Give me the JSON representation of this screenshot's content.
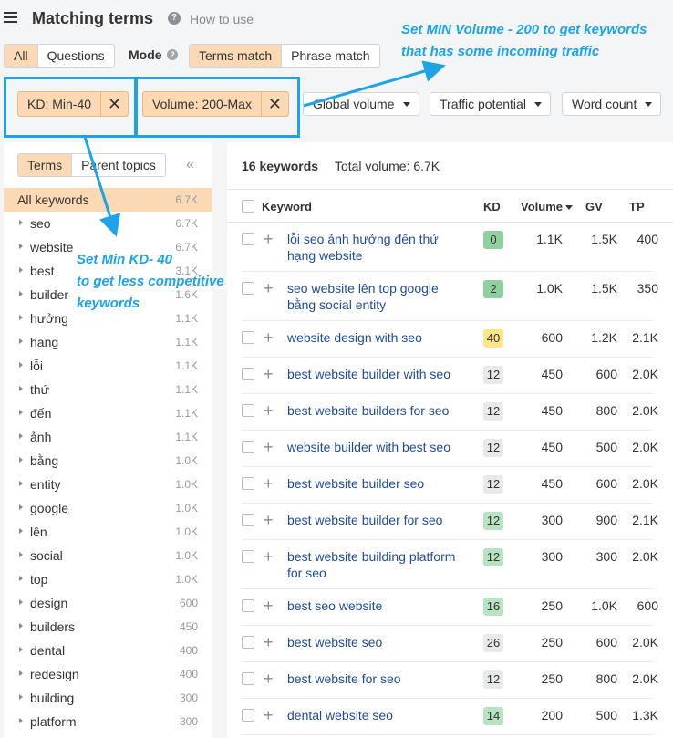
{
  "header": {
    "title": "Matching terms",
    "how_to_use": "How to use"
  },
  "toolbar": {
    "scope_tabs": [
      "All",
      "Questions"
    ],
    "mode_label": "Mode",
    "mode_tabs": [
      "Terms match",
      "Phrase match"
    ]
  },
  "filters": {
    "kd_chip": "KD: Min-40",
    "volume_chip": "Volume: 200-Max",
    "dropdowns": [
      "Global volume",
      "Traffic potential",
      "Word count"
    ]
  },
  "left_panel": {
    "tabs": [
      "Terms",
      "Parent topics"
    ],
    "terms": [
      {
        "name": "All keywords",
        "count": "6.7K"
      },
      {
        "name": "seo",
        "count": "6.7K"
      },
      {
        "name": "website",
        "count": "6.7K"
      },
      {
        "name": "best",
        "count": "3.1K"
      },
      {
        "name": "builder",
        "count": "1.6K"
      },
      {
        "name": "hưởng",
        "count": "1.1K"
      },
      {
        "name": "hạng",
        "count": "1.1K"
      },
      {
        "name": "lỗi",
        "count": "1.1K"
      },
      {
        "name": "thứ",
        "count": "1.1K"
      },
      {
        "name": "đến",
        "count": "1.1K"
      },
      {
        "name": "ảnh",
        "count": "1.1K"
      },
      {
        "name": "bằng",
        "count": "1.0K"
      },
      {
        "name": "entity",
        "count": "1.0K"
      },
      {
        "name": "google",
        "count": "1.0K"
      },
      {
        "name": "lên",
        "count": "1.0K"
      },
      {
        "name": "social",
        "count": "1.0K"
      },
      {
        "name": "top",
        "count": "1.0K"
      },
      {
        "name": "design",
        "count": "600"
      },
      {
        "name": "builders",
        "count": "450"
      },
      {
        "name": "dental",
        "count": "400"
      },
      {
        "name": "redesign",
        "count": "400"
      },
      {
        "name": "building",
        "count": "300"
      },
      {
        "name": "platform",
        "count": "300"
      }
    ]
  },
  "results": {
    "keyword_count": "16 keywords",
    "total_volume": "Total volume: 6.7K",
    "columns": [
      "Keyword",
      "KD",
      "Volume",
      "GV",
      "TP"
    ],
    "rows": [
      {
        "keyword": "lỗi seo ảnh hưởng đến thứ hạng website",
        "kd": "0",
        "kd_color": "#8fd19e",
        "volume": "1.1K",
        "gv": "1.5K",
        "tp": "400"
      },
      {
        "keyword": "seo website lên top google bằng social entity",
        "kd": "2",
        "kd_color": "#8fd19e",
        "volume": "1.0K",
        "gv": "1.5K",
        "tp": "350"
      },
      {
        "keyword": "website design with seo",
        "kd": "40",
        "kd_color": "#fde68a",
        "volume": "600",
        "gv": "1.2K",
        "tp": "2.1K"
      },
      {
        "keyword": "best website builder with seo",
        "kd": "12",
        "kd_color": "#e8e9eb",
        "volume": "450",
        "gv": "600",
        "tp": "2.0K"
      },
      {
        "keyword": "best website builders for seo",
        "kd": "12",
        "kd_color": "#e8e9eb",
        "volume": "450",
        "gv": "800",
        "tp": "2.0K"
      },
      {
        "keyword": "website builder with best seo",
        "kd": "12",
        "kd_color": "#e8e9eb",
        "volume": "450",
        "gv": "500",
        "tp": "2.0K"
      },
      {
        "keyword": "best website builder seo",
        "kd": "12",
        "kd_color": "#e8e9eb",
        "volume": "450",
        "gv": "600",
        "tp": "2.0K"
      },
      {
        "keyword": "best website builder for seo",
        "kd": "12",
        "kd_color": "#b7e3c0",
        "volume": "300",
        "gv": "900",
        "tp": "2.1K"
      },
      {
        "keyword": "best website building platform for seo",
        "kd": "12",
        "kd_color": "#b7e3c0",
        "volume": "300",
        "gv": "300",
        "tp": "2.0K"
      },
      {
        "keyword": "best seo website",
        "kd": "16",
        "kd_color": "#b7e3c0",
        "volume": "250",
        "gv": "1.0K",
        "tp": "600"
      },
      {
        "keyword": "best website seo",
        "kd": "26",
        "kd_color": "#e8e9eb",
        "volume": "250",
        "gv": "600",
        "tp": "2.0K"
      },
      {
        "keyword": "best website for seo",
        "kd": "12",
        "kd_color": "#e8e9eb",
        "volume": "250",
        "gv": "800",
        "tp": "2.0K"
      },
      {
        "keyword": "dental website seo",
        "kd": "14",
        "kd_color": "#b7e3c0",
        "volume": "200",
        "gv": "500",
        "tp": "1.3K"
      }
    ]
  },
  "annotations": {
    "volume_note": [
      "Set MIN Volume - 200 to get keywords",
      "that has some incoming traffic"
    ],
    "kd_note": [
      "Set Min KD- 40",
      "to get less competitive",
      "keywords"
    ],
    "color": "#1ca3e8"
  }
}
